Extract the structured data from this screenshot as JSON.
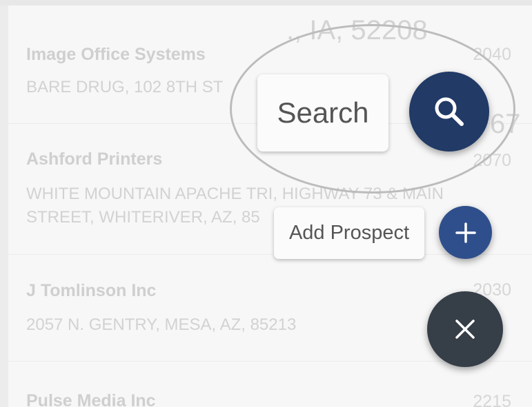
{
  "prospects": [
    {
      "name": "Image Office Systems",
      "address_lines": [
        "BARE DRUG, 102 8TH ST"
      ],
      "number": "2040"
    },
    {
      "name": "Ashford Printers",
      "address_lines": [
        "WHITE MOUNTAIN APACHE TRI, HIGHWAY 73 & MAIN",
        "STREET, WHITERIVER, AZ, 85"
      ],
      "number": "2070"
    },
    {
      "name": "J Tomlinson Inc",
      "address_lines": [
        "2057 N. GENTRY, MESA, AZ, 85213"
      ],
      "number": "2030"
    },
    {
      "name": "Pulse Media Inc",
      "address_lines": [],
      "number": "2215"
    }
  ],
  "background_ghost": {
    "top_text": "., IA, 52208",
    "mid_text": "67",
    "overlap_text": "AY 73 & MAIN"
  },
  "speed_dial": {
    "search_label": "Search",
    "add_prospect_label": "Add Prospect",
    "search_icon": "search-icon",
    "add_icon": "plus-icon",
    "close_icon": "close-icon"
  },
  "colors": {
    "search_fab": "#213a66",
    "add_fab": "#2f4f8c",
    "close_fab": "#363e48"
  }
}
